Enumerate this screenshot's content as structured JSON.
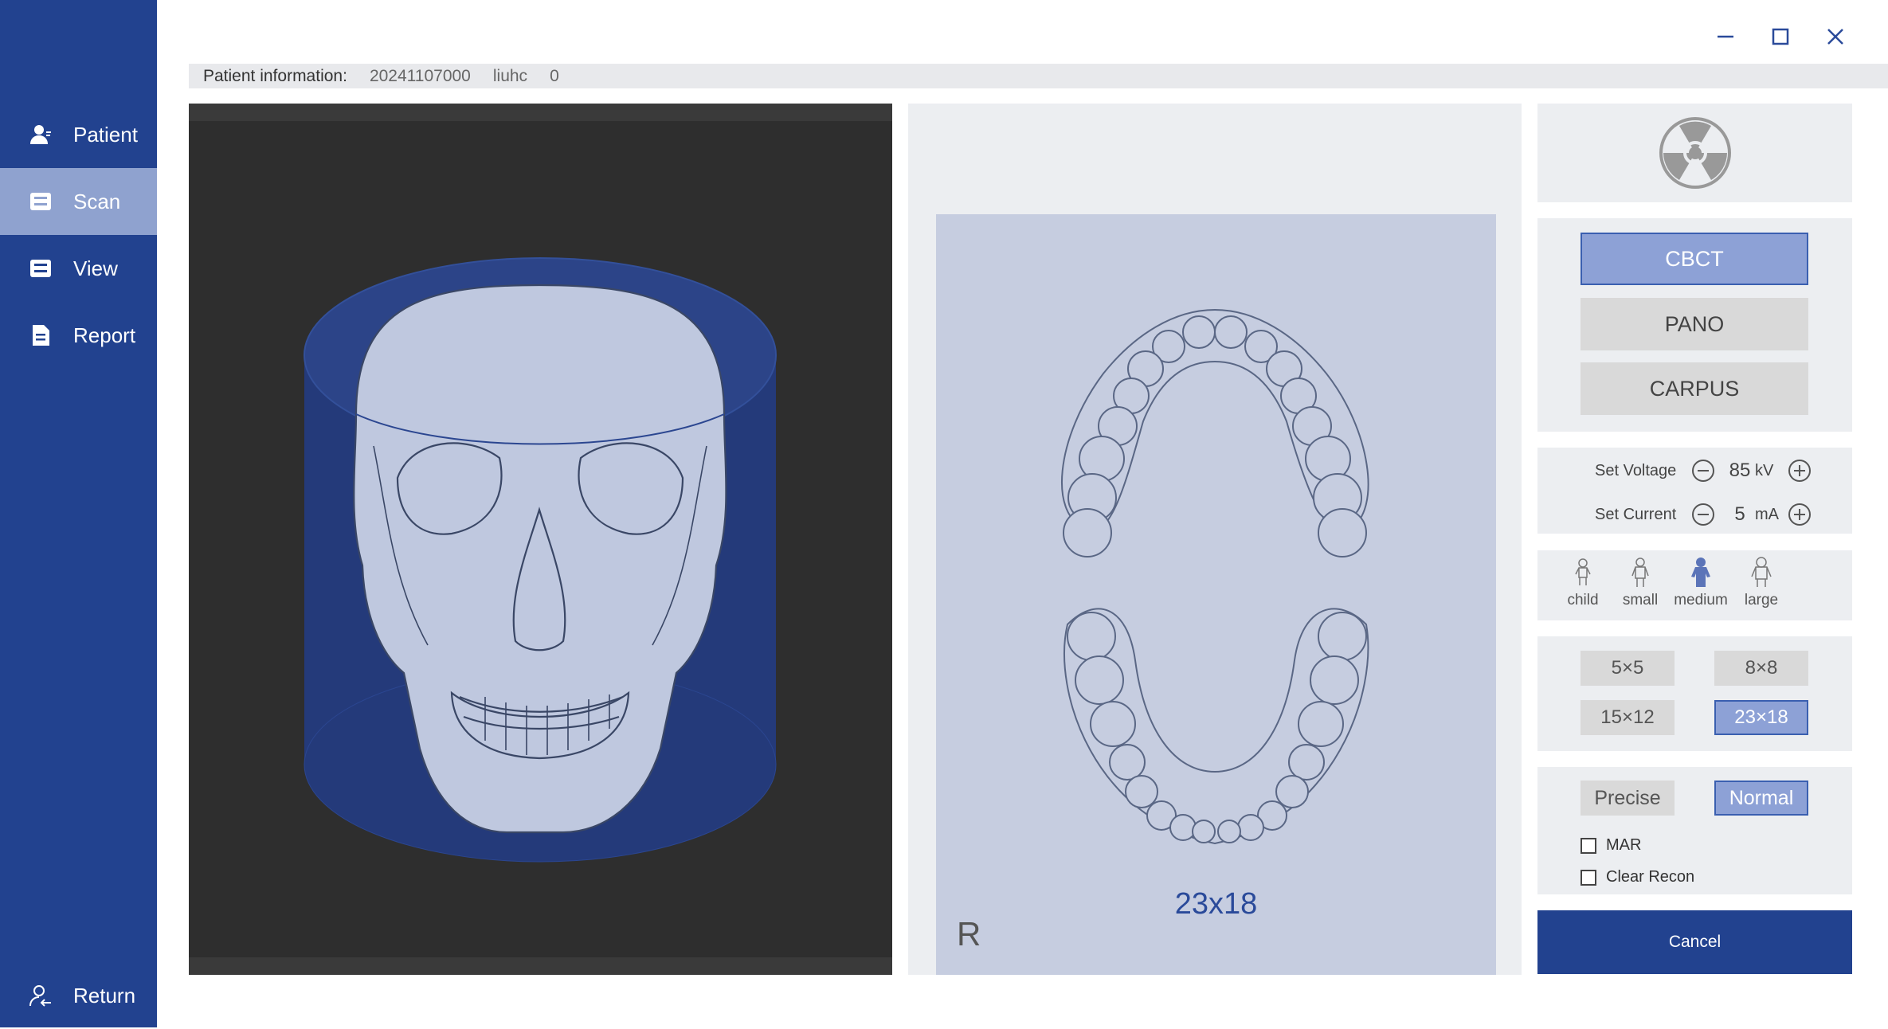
{
  "sidebar": {
    "items": [
      {
        "label": "Patient",
        "icon": "user-icon",
        "active": false
      },
      {
        "label": "Scan",
        "icon": "scan-icon",
        "active": true
      },
      {
        "label": "View",
        "icon": "view-icon",
        "active": false
      },
      {
        "label": "Report",
        "icon": "report-icon",
        "active": false
      }
    ],
    "return_label": "Return"
  },
  "window_controls": [
    "minimize-icon",
    "maximize-icon",
    "close-icon"
  ],
  "patient_info": {
    "label": "Patient information:",
    "id": "20241107000",
    "name": "liuhc",
    "extra": "0"
  },
  "arch_view": {
    "fov_label": "23x18",
    "orientation_label": "R"
  },
  "controls": {
    "modes": [
      {
        "label": "CBCT",
        "active": true
      },
      {
        "label": "PANO",
        "active": false
      },
      {
        "label": "CARPUS",
        "active": false
      }
    ],
    "voltage": {
      "label": "Set Voltage",
      "value": "85",
      "unit": "kV"
    },
    "current": {
      "label": "Set Current",
      "value": "5",
      "unit": "mA"
    },
    "patient_sizes": [
      {
        "label": "child",
        "active": false
      },
      {
        "label": "small",
        "active": false
      },
      {
        "label": "medium",
        "active": true
      },
      {
        "label": "large",
        "active": false
      }
    ],
    "fov_options": [
      {
        "label": "5×5",
        "active": false
      },
      {
        "label": "8×8",
        "active": false
      },
      {
        "label": "15×12",
        "active": false
      },
      {
        "label": "23×18",
        "active": true
      }
    ],
    "quality": [
      {
        "label": "Precise",
        "active": false
      },
      {
        "label": "Normal",
        "active": true
      }
    ],
    "checkboxes": [
      {
        "label": "MAR",
        "checked": false
      },
      {
        "label": "Clear Recon",
        "checked": false
      }
    ],
    "cancel_label": "Cancel"
  },
  "colors": {
    "sidebar": "#22428f",
    "sidebar_active": "#8fa2cf",
    "accent_active": "#8da1d6",
    "button_primary": "#22428f"
  }
}
